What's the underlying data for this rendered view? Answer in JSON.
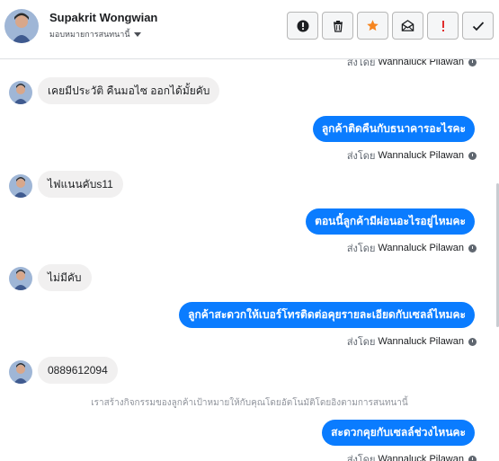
{
  "header": {
    "contact_name": "Supakrit Wongwian",
    "assign_label": "มอบหมายการสนทนานี้",
    "tools": [
      {
        "name": "info-button",
        "icon": "exclamation-circle-icon"
      },
      {
        "name": "delete-button",
        "icon": "trash-icon"
      },
      {
        "name": "star-button",
        "icon": "star-icon",
        "color": "#f6851f"
      },
      {
        "name": "mark-unread-button",
        "icon": "envelope-open-icon"
      },
      {
        "name": "mark-spam-button",
        "icon": "exclamation-icon",
        "color": "#e02d2d"
      },
      {
        "name": "mark-done-button",
        "icon": "check-icon"
      }
    ]
  },
  "sent_by_prefix": "ส่งโดย",
  "agent_name": "Wannaluck Pilawan",
  "messages": [
    {
      "direction": "in",
      "text": "เคยมีประวัติ คืนมอไซ ออกได้มั้ยคับ"
    },
    {
      "direction": "out",
      "text": "ลูกค้าติดคืนกับธนาคารอะไรคะ"
    },
    {
      "direction": "in",
      "text": "ไฟแนนคับs11"
    },
    {
      "direction": "out",
      "text": "ตอนนี้ลูกค้ามีผ่อนอะไรอยู่ไหมคะ"
    },
    {
      "direction": "in",
      "text": "ไม่มีคับ"
    },
    {
      "direction": "out",
      "text": "ลูกค้าสะดวกให้เบอร์โทรติดต่อคุยรายละเอียดกับเซลล์ไหมคะ"
    },
    {
      "direction": "in",
      "text": "0889612094"
    },
    {
      "direction": "out",
      "text": "สะดวกคุยกับเซลล์ช่วงไหนคะ"
    }
  ],
  "system_note": "เราสร้างกิจกรรมของลูกค้าเป้าหมายให้กับคุณโดยอัตโนมัติโดยอิงตามการสนทนานี้",
  "colors": {
    "outgoing_bubble": "#0a7cff",
    "incoming_bubble": "#f1f0f0",
    "star": "#f6851f",
    "spam": "#e02d2d"
  }
}
